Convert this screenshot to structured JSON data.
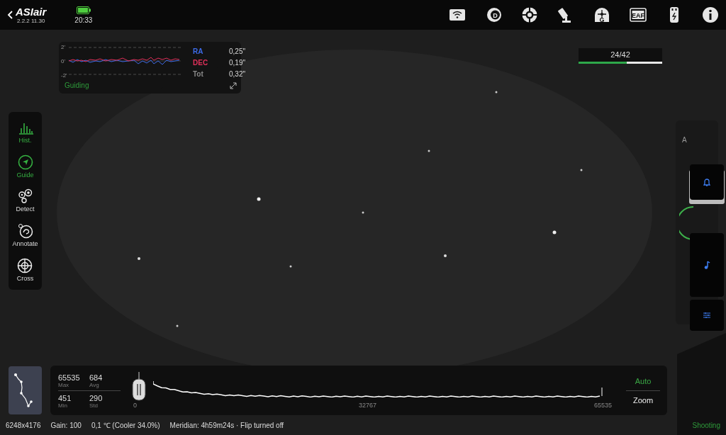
{
  "header": {
    "logo": "ASIair",
    "version": "2.2.2 11.30",
    "time": "20:33"
  },
  "device_icons": [
    {
      "kind": "wifi"
    },
    {
      "kind": "filter",
      "label": "D"
    },
    {
      "kind": "target"
    },
    {
      "kind": "mount"
    },
    {
      "kind": "guide",
      "label": "G"
    },
    {
      "kind": "focuser",
      "label": "EAF"
    },
    {
      "kind": "usb"
    },
    {
      "kind": "info"
    }
  ],
  "guiding": {
    "axis_labels": [
      "2'",
      "0'",
      "-2'"
    ],
    "legend": [
      {
        "name": "RA",
        "value": "0,25\"",
        "color": "#3d6be8"
      },
      {
        "name": "DEC",
        "value": "0,19\"",
        "color": "#e0305a"
      },
      {
        "name": "Tot",
        "value": "0,32\"",
        "color": "#8a8a8a"
      }
    ],
    "status": "Guiding"
  },
  "sequence": {
    "progress": "24/42",
    "level": 0.58
  },
  "tools": [
    {
      "label": "Hist.",
      "kind": "histogram",
      "active": true
    },
    {
      "label": "Guide",
      "kind": "guide",
      "active": true
    },
    {
      "label": "Detect",
      "kind": "detect",
      "active": false
    },
    {
      "label": "Annotate",
      "kind": "annotate",
      "active": false
    },
    {
      "label": "Cross",
      "kind": "cross",
      "active": false
    }
  ],
  "side_panel": {
    "label": "A",
    "buttons": [
      {
        "kind": "bell"
      },
      {
        "kind": "music"
      },
      {
        "kind": "sliders"
      }
    ]
  },
  "histogram": {
    "stats": [
      {
        "value": "65535",
        "label": "Max"
      },
      {
        "value": "684",
        "label": "Avg"
      },
      {
        "value": "451",
        "label": "Min"
      },
      {
        "value": "290",
        "label": "Std"
      }
    ],
    "scale": [
      "0",
      "32767",
      "65535"
    ],
    "buttons": [
      {
        "label": "Auto",
        "active": true
      },
      {
        "label": "Zoom",
        "active": false
      }
    ]
  },
  "status_bar": {
    "items": [
      "6248x4176",
      "Gain: 100",
      "0,1 ℃ (Cooler 34.0%)",
      "Meridian: 4h59m24s · Flip turned off"
    ],
    "state": "Shooting"
  }
}
